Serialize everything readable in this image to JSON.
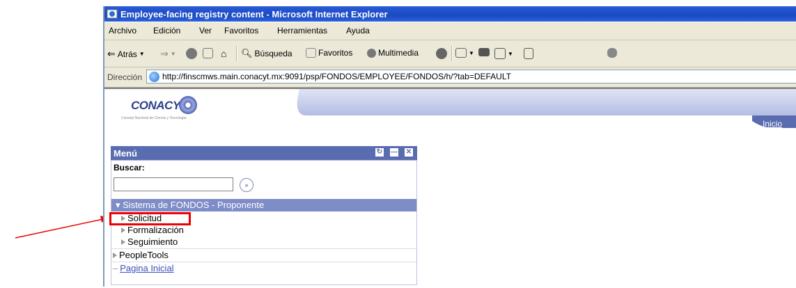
{
  "window": {
    "title": "Employee-facing registry content - Microsoft Internet Explorer"
  },
  "menubar": {
    "items": [
      "Archivo",
      "Edición",
      "Ver",
      "Favoritos",
      "Herramientas",
      "Ayuda"
    ]
  },
  "toolbar": {
    "back_label": "Atrás",
    "search_label": "Búsqueda",
    "favorites_label": "Favoritos",
    "media_label": "Multimedia"
  },
  "addressbar": {
    "label": "Dirección",
    "url": "http://finscmws.main.conacyt.mx:9091/psp/FONDOS/EMPLOYEE/FONDOS/h/?tab=DEFAULT"
  },
  "banner": {
    "logo_text": "CONACYT",
    "logo_subtitle": "Consejo Nacional de Ciencia y Tecnología",
    "home_link": "Inicio"
  },
  "menu": {
    "title": "Menú",
    "search_label": "Buscar:",
    "search_value": "",
    "go_symbol": "»",
    "section": "Sistema de FONDOS - Proponente",
    "items": [
      "Solicitud",
      "Formalización",
      "Seguimiento"
    ],
    "peopletools": "PeopleTools",
    "home_page": "Pagina Inicial"
  },
  "colors": {
    "titlebar": "#1a4ac0",
    "portlet_header": "#5a6cb0",
    "section_bar": "#7e8cc8",
    "annotation": "#ee0000"
  }
}
